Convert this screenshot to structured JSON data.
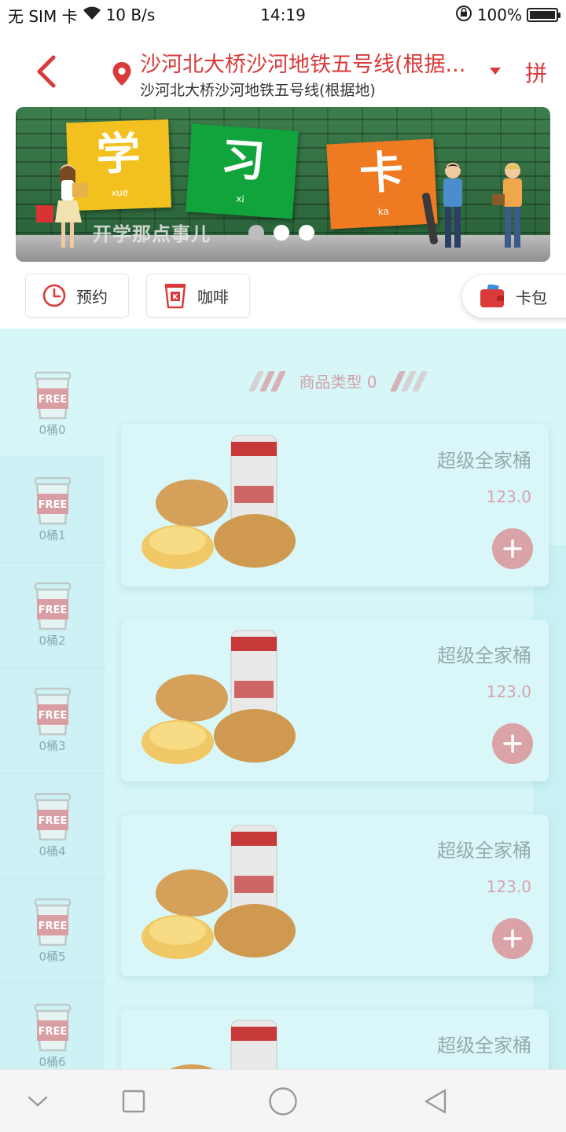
{
  "status_bar": {
    "carrier": "无 SIM 卡",
    "speed": "10 B/s",
    "time": "14:19",
    "battery": "100%",
    "battery_level": 1.0
  },
  "header": {
    "location_main": "沙河北大桥沙河地铁五号线(根据...",
    "location_sub": "沙河北大桥沙河地铁五号线(根据地)",
    "group_label": "拼"
  },
  "banner": {
    "cards": [
      {
        "char": "学",
        "pinyin": "xue"
      },
      {
        "char": "习",
        "pinyin": "xi"
      },
      {
        "char": "卡",
        "pinyin": "ka"
      }
    ],
    "slogan": "开学那点事儿",
    "slide_count": 3,
    "active_slide": 0
  },
  "quick_actions": {
    "reserve_label": "预约",
    "coffee_label": "咖啡",
    "wallet_label": "卡包"
  },
  "sidebar": {
    "badge": "FREE",
    "items": [
      {
        "label": "0桶0"
      },
      {
        "label": "0桶1"
      },
      {
        "label": "0桶2"
      },
      {
        "label": "0桶3"
      },
      {
        "label": "0桶4"
      },
      {
        "label": "0桶5"
      },
      {
        "label": "0桶6"
      }
    ]
  },
  "section": {
    "title": "商品类型 0"
  },
  "products": [
    {
      "name": "超级全家桶",
      "price": "123.0"
    },
    {
      "name": "超级全家桶",
      "price": "123.0"
    },
    {
      "name": "超级全家桶",
      "price": "123.0"
    },
    {
      "name": "超级全家桶",
      "price": ""
    }
  ],
  "colors": {
    "brand_red": "#d93a3a",
    "content_bg": "#d6f6f8",
    "add_button": "#d9a3a8"
  }
}
